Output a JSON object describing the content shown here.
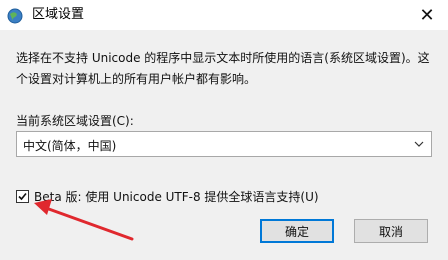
{
  "window": {
    "title": "区域设置",
    "close_symbol": "✕",
    "icon": "globe-icon"
  },
  "dialog": {
    "description_line1": "选择在不支持 Unicode 的程序中显示文本时所使用的语言(系统区域设置)。这",
    "description_line2": "个设置对计算机上的所有用户帐户都有影响。",
    "current_locale_label": "当前系统区域设置(C):",
    "current_locale_value": "中文(简体，中国)",
    "beta_checkbox_label": "Beta 版: 使用 Unicode UTF-8 提供全球语言支持(U)",
    "beta_checked": true
  },
  "buttons": {
    "ok_label": "确定",
    "cancel_label": "取消"
  },
  "colors": {
    "annotation_arrow": "#e0282e",
    "accent_border": "#0078d7"
  }
}
